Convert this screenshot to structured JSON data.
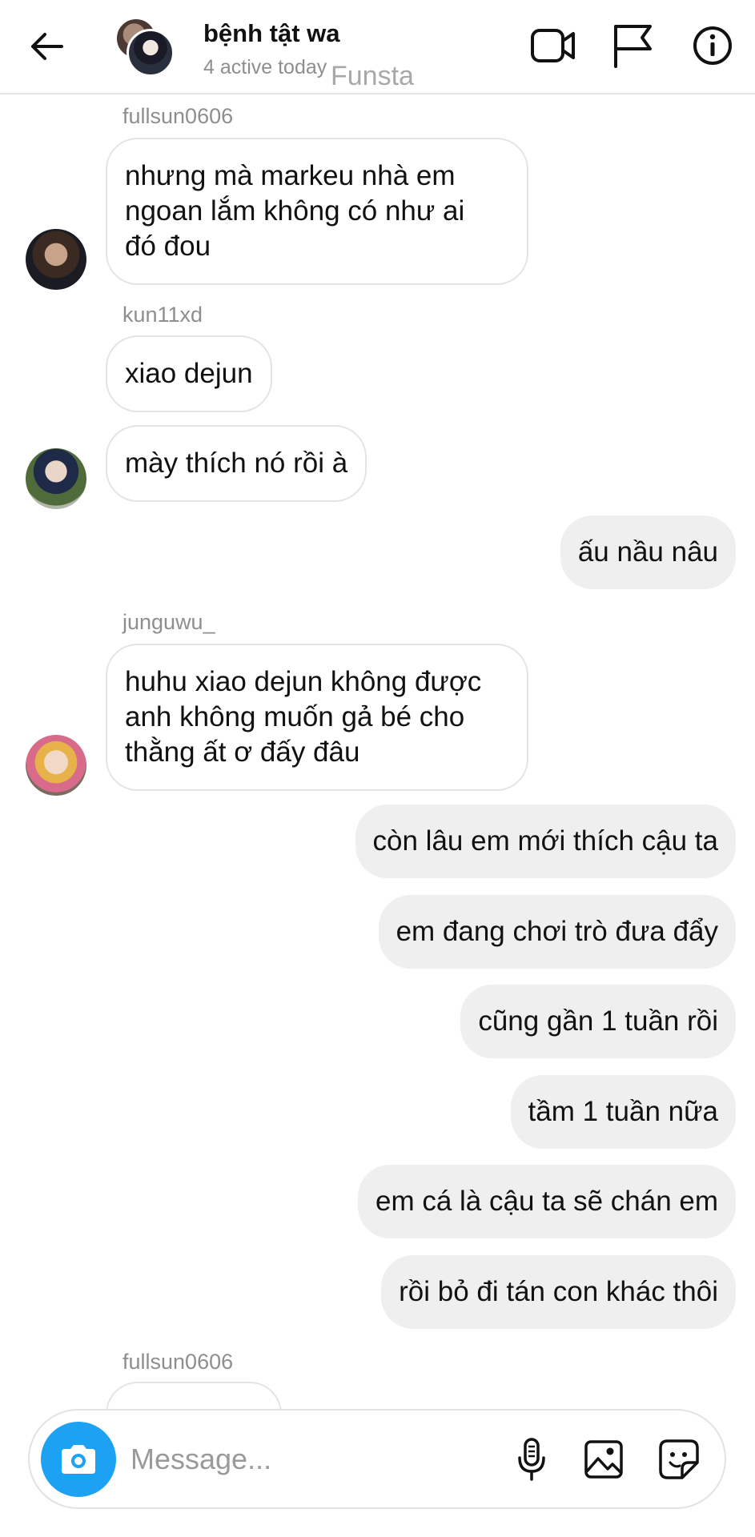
{
  "header": {
    "title": "bệnh tật wa",
    "subtitle": "4 active today",
    "watermark": "Funsta",
    "icons": {
      "back": "arrow-left-icon",
      "video": "video-camera-icon",
      "report": "flag-icon",
      "info": "info-icon"
    }
  },
  "messages": [
    {
      "sender": "fullsun0606",
      "direction": "in",
      "lines": [
        "nhưng mà markeu nhà em",
        "ngoan lắm không có như ai",
        "đó đou"
      ]
    },
    {
      "sender": "kun11xd",
      "direction": "in",
      "lines": [
        "xiao dejun"
      ]
    },
    {
      "sender": "",
      "direction": "in",
      "lines": [
        "mày thích nó rồi à"
      ]
    },
    {
      "sender": "",
      "direction": "out",
      "lines": [
        "ấu nầu nâu"
      ]
    },
    {
      "sender": "junguwu_",
      "direction": "in",
      "lines": [
        "huhu xiao dejun không được",
        "anh không muốn gả bé cho",
        "thằng ất ơ đấy đâu"
      ]
    },
    {
      "sender": "",
      "direction": "out",
      "lines": [
        "còn lâu em mới thích cậu ta"
      ]
    },
    {
      "sender": "",
      "direction": "out",
      "lines": [
        "em đang chơi trò đưa đẩy"
      ]
    },
    {
      "sender": "",
      "direction": "out",
      "lines": [
        "cũng gần 1 tuần rồi"
      ]
    },
    {
      "sender": "",
      "direction": "out",
      "lines": [
        "tầm 1 tuần nữa"
      ]
    },
    {
      "sender": "",
      "direction": "out",
      "lines": [
        "em cá là cậu ta sẽ chán em"
      ]
    },
    {
      "sender": "",
      "direction": "out",
      "lines": [
        "rồi bỏ đi tán con khác thôi"
      ]
    },
    {
      "sender": "fullsun0606",
      "direction": "in",
      "lines": []
    }
  ],
  "composer": {
    "placeholder": "Message...",
    "icons": {
      "camera": "camera-icon",
      "mic": "microphone-icon",
      "gallery": "image-icon",
      "sticker": "sticker-icon"
    }
  },
  "colors": {
    "camera_button": "#1da1f2",
    "outgoing_bubble": "#efefef",
    "incoming_border": "#e4e4e4",
    "secondary_text": "#8e8e8e"
  }
}
